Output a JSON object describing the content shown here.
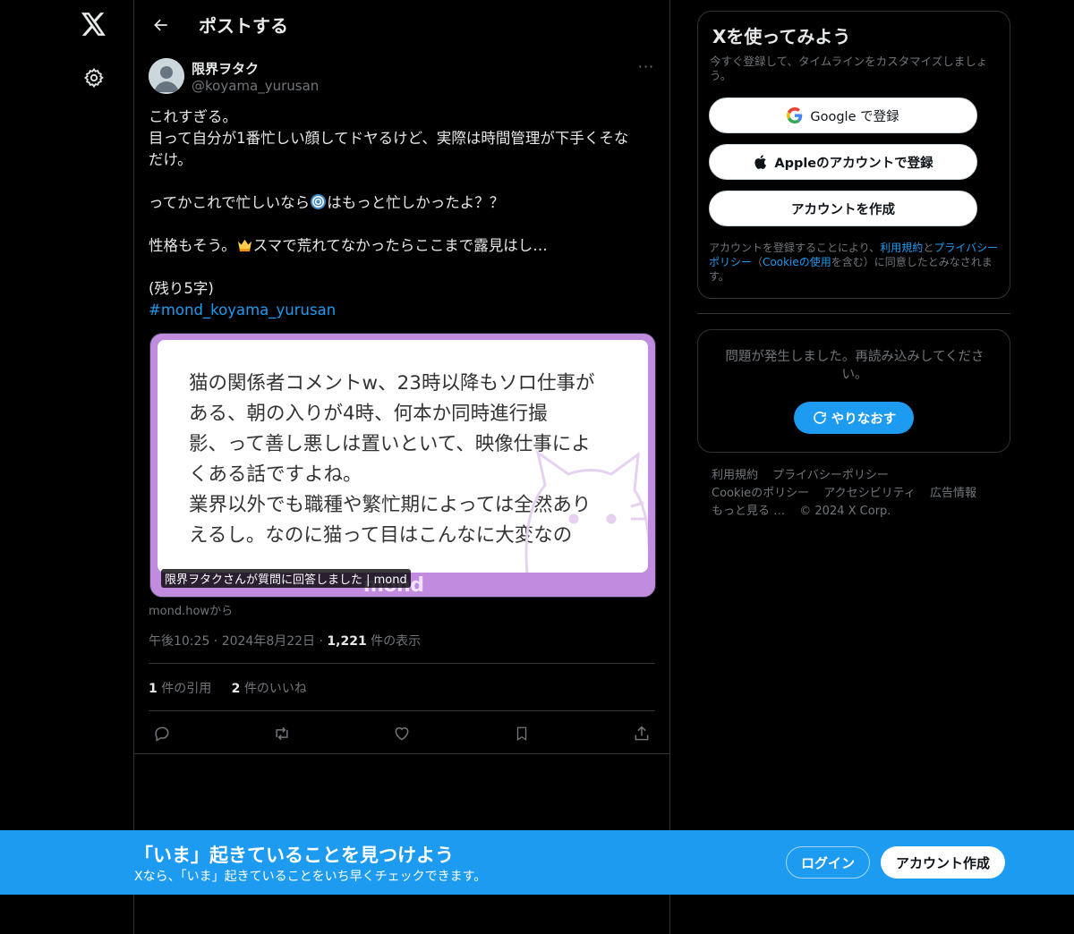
{
  "header": {
    "title": "ポストする"
  },
  "post": {
    "author_name": "限界ヲタク",
    "author_handle": "@koyama_yurusan",
    "more": "···",
    "lines": {
      "l1": "これすぎる。",
      "l2": "目って自分が1番忙しい顔してドヤるけど、実際は時間管理が下手くそな",
      "l3": "だけ。",
      "l4": "ってかこれで忙しいなら",
      "l4b": "はもっと忙しかったよ？？",
      "l5": "性格もそう。",
      "l5b": "スマで荒れてなかったらここまで露見はし…",
      "l6": "(残り5字)",
      "hashtag": "#mond_koyama_yurusan"
    },
    "card": {
      "lines": {
        "c1": "猫の関係者コメントw、23時以降もソロ仕事が",
        "c2": "ある、朝の入りが4時、何本か同時進行撮",
        "c3": "影、って善し悪しは置いといて、映像仕事によ",
        "c4": "くある話ですよね。",
        "c5": "業界以外でも職種や繁忙期によっては全然あり",
        "c6": "えるし。なのに猫って目はこんなに大変なの"
      },
      "caption": "限界ヲタクさんが質問に回答しました | mond",
      "watermark": "mond",
      "source": "mond.howから"
    },
    "meta": {
      "time": "午後10:25 · 2024年8月22日 · ",
      "views": "1,221",
      "views_label": " 件の表示"
    },
    "stats": {
      "quotes": "1",
      "quotes_label": " 件の引用",
      "likes": "2",
      "likes_label": " 件のいいね"
    }
  },
  "sidebar": {
    "title": "Xを使ってみよう",
    "subtitle": "今すぐ登録して、タイムラインをカスタマイズしましょう。",
    "google_label": "Google で登録",
    "apple_label": "Appleのアカウントで登録",
    "create_label": "アカウントを作成",
    "legal": {
      "p1": "アカウントを登録することにより、",
      "terms": "利用規約",
      "and": "と",
      "privacy": "プライバシーポリシー",
      "p2": "（",
      "cookie": "Cookieの使用",
      "p3": "を含む）に同意したとみなされます。"
    },
    "error_text": "問題が発生しました。再読み込みしてください。",
    "retry_label": "やりなおす",
    "footer": {
      "terms": "利用規約",
      "privacy": "プライバシーポリシー",
      "cookie": "Cookieのポリシー",
      "accessibility": "アクセシビリティ",
      "ads": "広告情報",
      "more": "もっと見る …",
      "copyright": "© 2024 X Corp."
    }
  },
  "banner": {
    "title": "「いま」起きていることを見つけよう",
    "subtitle": "Xなら、「いま」起きていることをいち早くチェックできます。",
    "login_label": "ログイン",
    "signup_label": "アカウント作成"
  },
  "colors": {
    "accent": "#1d9bf0",
    "background": "#000000",
    "card_frame": "#c18ce0"
  },
  "icons": [
    "x-logo-icon",
    "gear-icon",
    "back-arrow-icon",
    "more-icon",
    "reply-icon",
    "repost-icon",
    "like-icon",
    "bookmark-icon",
    "share-icon",
    "google-icon",
    "apple-icon",
    "refresh-icon"
  ]
}
